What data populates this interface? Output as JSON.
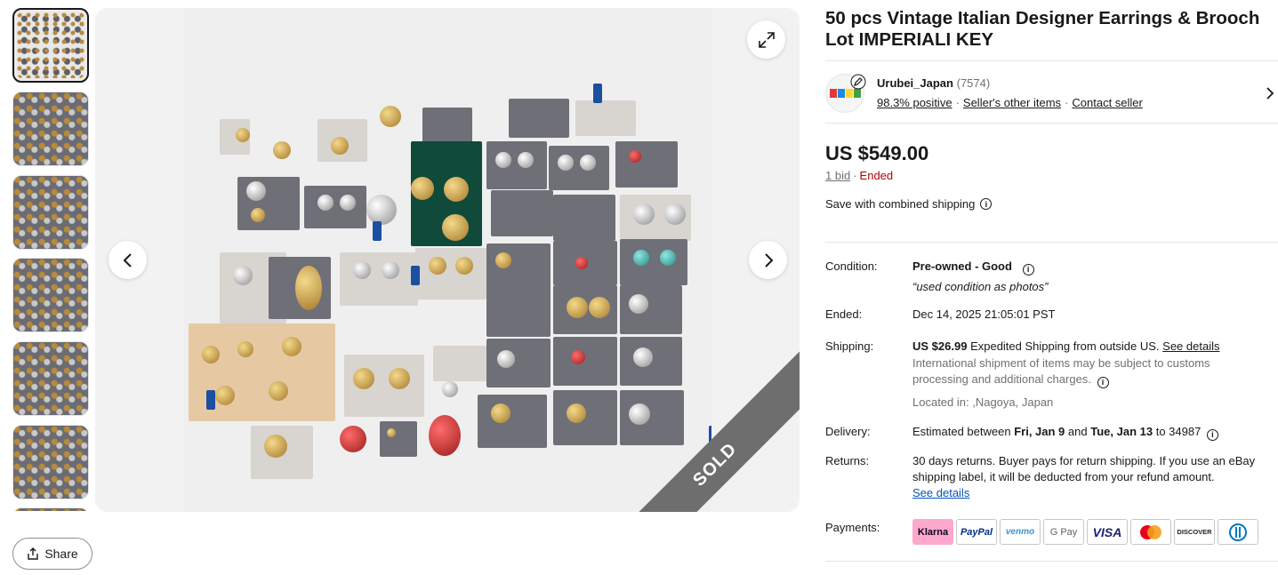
{
  "listing": {
    "title": "50 pcs Vintage Italian Designer Earrings & Brooch Lot IMPERIALI KEY",
    "sold_label": "SOLD"
  },
  "gallery": {
    "thumbnail_count": 6,
    "share_label": "Share"
  },
  "seller": {
    "name": "Urubei_Japan",
    "feedback_count": "(7574)",
    "positive": "98.3% positive",
    "other_items": "Seller's other items",
    "contact": "Contact seller"
  },
  "price": {
    "amount": "US $549.00",
    "bids": "1 bid",
    "status": "Ended",
    "combined_shipping": "Save with combined shipping"
  },
  "details": {
    "condition_label": "Condition:",
    "condition_value": "Pre-owned - Good",
    "condition_note": "“used condition as photos”",
    "ended_label": "Ended:",
    "ended_value": "Dec 14, 2025 21:05:01 PST",
    "shipping_label": "Shipping:",
    "shipping_price": "US $26.99",
    "shipping_method": "Expedited Shipping from outside US.",
    "shipping_see_details": "See details",
    "shipping_customs": "International shipment of items may be subject to customs processing and additional charges.",
    "located": "Located in: ,Nagoya, Japan",
    "delivery_label": "Delivery:",
    "delivery_prefix": "Estimated between",
    "delivery_start": "Fri, Jan 9",
    "delivery_and": "and",
    "delivery_end": "Tue, Jan 13",
    "delivery_to": "to 34987",
    "returns_label": "Returns:",
    "returns_text": "30 days returns. Buyer pays for return shipping. If you use an eBay shipping label, it will be deducted from your refund amount.",
    "returns_see_details": "See details",
    "payments_label": "Payments:"
  },
  "payments": [
    "Klarna",
    "PayPal",
    "venmo",
    "G Pay",
    "VISA",
    "Mastercard",
    "DISCOVER",
    "Diners"
  ],
  "colors": {
    "link": "#0654ba",
    "ended": "#b30000",
    "klarna": "#ffa8cd",
    "paypal": "#003087",
    "venmo": "#3d95ce",
    "visa": "#1a1f71"
  }
}
